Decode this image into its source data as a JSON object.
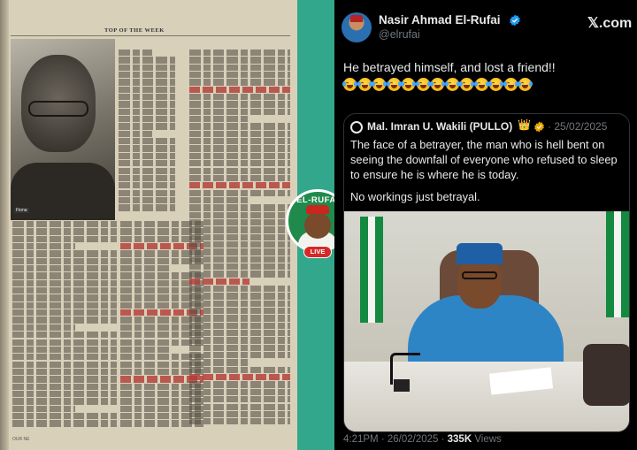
{
  "magazine": {
    "section_header": "TOP OF THE WEEK",
    "photo_caption": "Fiona",
    "footer": "OUR NE"
  },
  "badge": {
    "name": "EL-RUFAI",
    "live_label": "LIVE"
  },
  "tweet": {
    "author_name": "Nasir Ahmad El-Rufai",
    "handle": "@elrufai",
    "platform_logo": "𝕏.com",
    "text": "He betrayed himself, and lost a friend!!",
    "emoji_count": 13,
    "quoted": {
      "author_name": "Mal. Imran U. Wakili (PULLO)",
      "crown": "👑",
      "separator": "·",
      "date": "25/02/2025",
      "text": "The face of a betrayer, the man who is hell bent on seeing the downfall of everyone who refused to sleep to ensure he is where he is today.",
      "text2": "No workings just betrayal."
    },
    "meta": {
      "time_date": "4:21PM · 26/02/2025 ·",
      "views_count": "335K",
      "views_label": "Views"
    }
  },
  "colors": {
    "background_teal": "#33a78c",
    "tweet_bg": "#000000",
    "verified_blue": "#1d9bf0",
    "badge_green": "#1f8a4c",
    "live_red": "#d62828"
  },
  "icons": [
    "verified-badge-icon",
    "x-logo",
    "crown-icon",
    "tears-of-joy-emoji"
  ]
}
